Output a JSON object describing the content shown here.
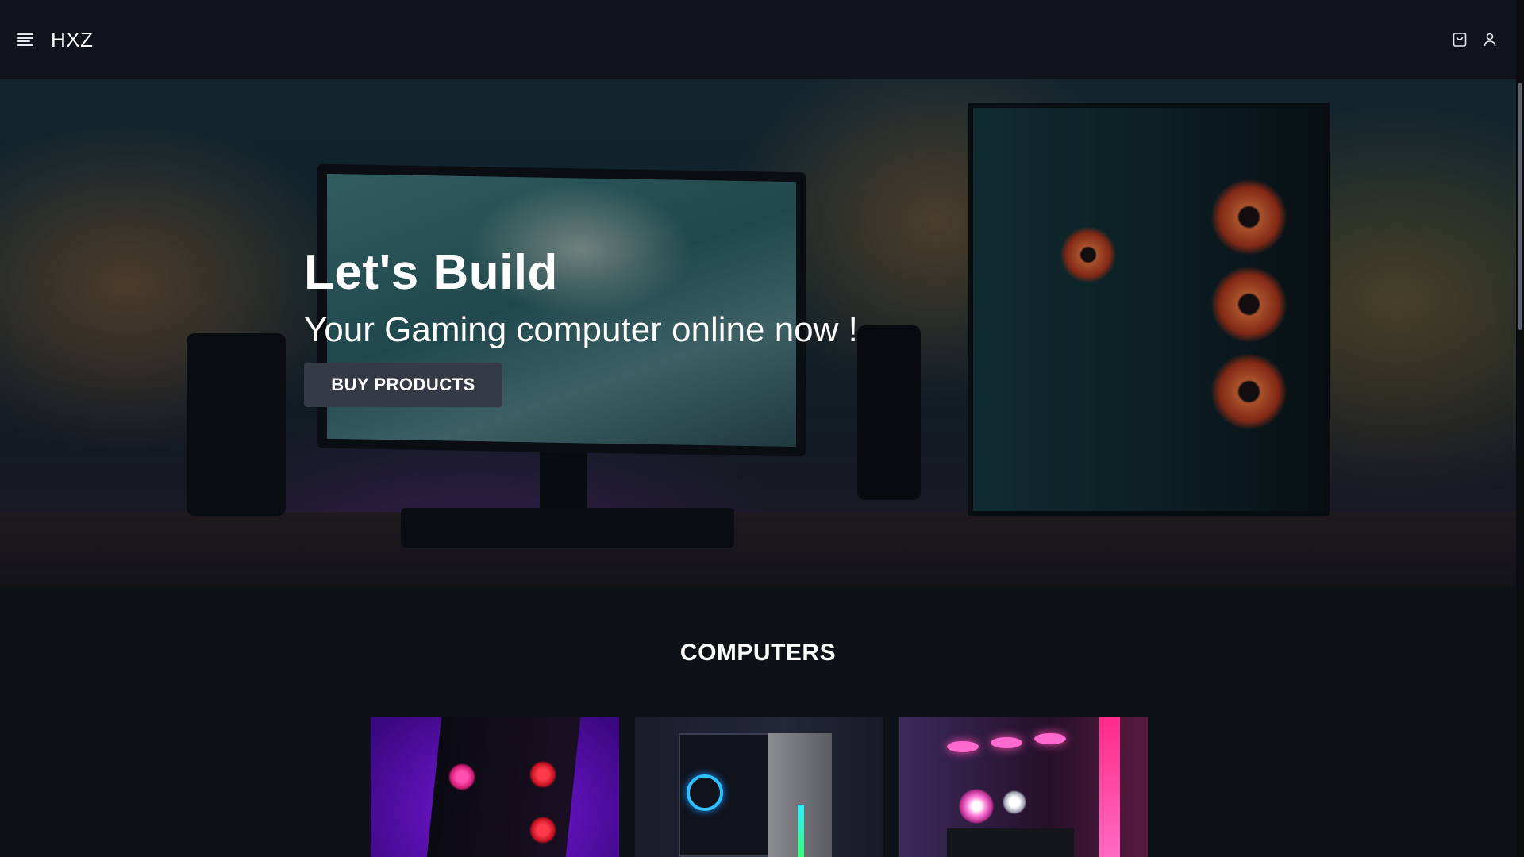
{
  "nav": {
    "brand": "HXZ",
    "menu_icon": "menu-icon",
    "cart_icon": "shopping-bag-icon",
    "account_icon": "user-icon"
  },
  "hero": {
    "title": "Let's Build",
    "subtitle": "Your Gaming computer online now !",
    "button_label": "BUY PRODUCTS"
  },
  "computers": {
    "heading": "COMPUTERS",
    "cards": [
      {
        "image": "pc-case-purple-image"
      },
      {
        "image": "pc-case-blue-image"
      },
      {
        "image": "pc-case-pink-image"
      }
    ]
  },
  "colors": {
    "background": "#0e1117",
    "navbar": "#0f131b",
    "button": "#343a46",
    "text": "#ffffff"
  }
}
